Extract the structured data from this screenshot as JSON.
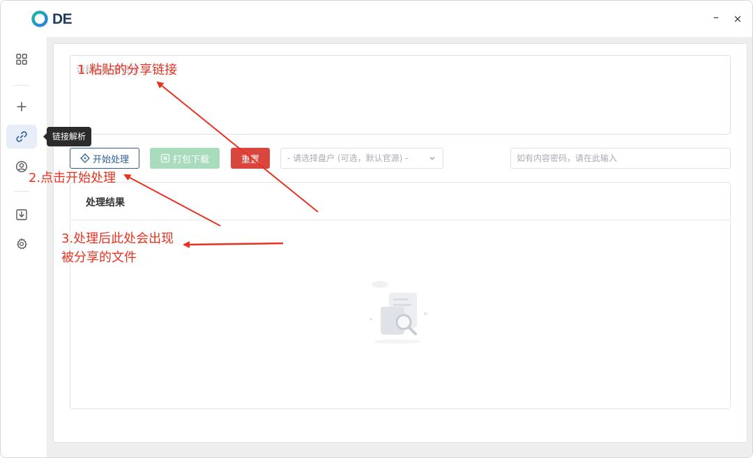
{
  "app": {
    "logo_text": "DE",
    "window_controls": {
      "minimize": "–",
      "close": "×"
    }
  },
  "sidebar": {
    "items": [
      {
        "name": "apps",
        "icon": "grid-icon"
      },
      {
        "name": "add",
        "icon": "plus-icon"
      },
      {
        "name": "link-parse",
        "icon": "link-icon",
        "active": true
      },
      {
        "name": "account",
        "icon": "user-circle-icon"
      },
      {
        "name": "download",
        "icon": "download-icon"
      },
      {
        "name": "settings",
        "icon": "gear-icon"
      }
    ],
    "tooltip": "链接解析"
  },
  "main": {
    "link_input": {
      "placeholder": "请粘贴分享链接",
      "value": ""
    },
    "buttons": {
      "start": "开始处理",
      "pack_download": "打包下载",
      "reset": "重置"
    },
    "drive_select": {
      "placeholder": "- 请选择盘户 (可选，默认官源) -"
    },
    "password_input": {
      "placeholder": "如有内容密码，请在此输入"
    },
    "result": {
      "title": "处理结果"
    }
  },
  "annotations": {
    "step1": "1.粘贴的分享链接",
    "step2": "2.点击开始处理",
    "step3_line1": "3.处理后此处会出现",
    "step3_line2": "被分享的文件"
  },
  "colors": {
    "primary": "#2c5d99",
    "success_disabled": "#a9dcbc",
    "danger": "#d9463e",
    "annotation": "#e8321f",
    "sidebar_active": "#e8eef8"
  }
}
